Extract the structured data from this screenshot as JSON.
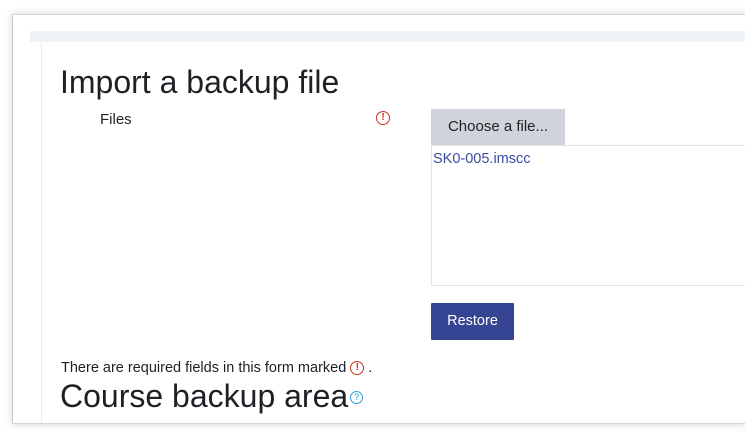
{
  "page": {
    "title": "Import a backup file"
  },
  "form": {
    "files_label": "Files",
    "required_icon": "!",
    "choose_button_label": "Choose a file...",
    "selected_file": "SK0-005.imscc",
    "restore_button_label": "Restore",
    "required_note_before": "There are required fields in this form marked",
    "required_note_after": "."
  },
  "section": {
    "title": "Course backup area",
    "help_icon": "?"
  },
  "colors": {
    "primary": "#354593",
    "required": "#ca3120",
    "link": "#3b4ba1",
    "help": "#2f9dd8"
  },
  "icons": {
    "required": "exclamation-circle-icon",
    "help": "question-circle-icon"
  }
}
